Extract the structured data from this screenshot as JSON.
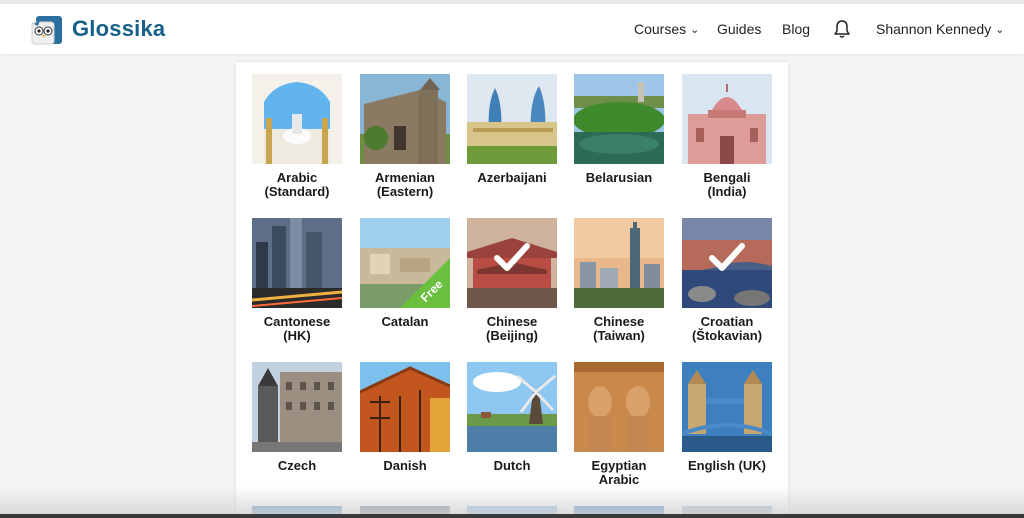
{
  "app": {
    "name": "Glossika"
  },
  "nav": {
    "courses": "Courses",
    "guides": "Guides",
    "blog": "Blog",
    "user": "Shannon Kennedy",
    "chevron": "⌄"
  },
  "courses": [
    {
      "line1": "Arabic",
      "line2": "(Standard)"
    },
    {
      "line1": "Armenian",
      "line2": "(Eastern)"
    },
    {
      "line1": "Azerbaijani",
      "line2": ""
    },
    {
      "line1": "Belarusian",
      "line2": ""
    },
    {
      "line1": "Bengali",
      "line2": "(India)"
    },
    {
      "line1": "Cantonese",
      "line2": "(HK)"
    },
    {
      "line1": "Catalan",
      "line2": "",
      "badge": "Free"
    },
    {
      "line1": "Chinese",
      "line2": "(Beijing)",
      "selected": true
    },
    {
      "line1": "Chinese",
      "line2": "(Taiwan)"
    },
    {
      "line1": "Croatian",
      "line2": "(Štokavian)",
      "selected": true
    },
    {
      "line1": "Czech",
      "line2": ""
    },
    {
      "line1": "Danish",
      "line2": ""
    },
    {
      "line1": "Dutch",
      "line2": ""
    },
    {
      "line1": "Egyptian",
      "line2": "Arabic"
    },
    {
      "line1": "English (UK)",
      "line2": ""
    }
  ],
  "colors": {
    "brand": "#17608a",
    "free_badge": "#6abf3f"
  },
  "icons": [
    "owl-logo-icon",
    "bell-icon",
    "checkmark-icon",
    "chevron-down-icon"
  ]
}
